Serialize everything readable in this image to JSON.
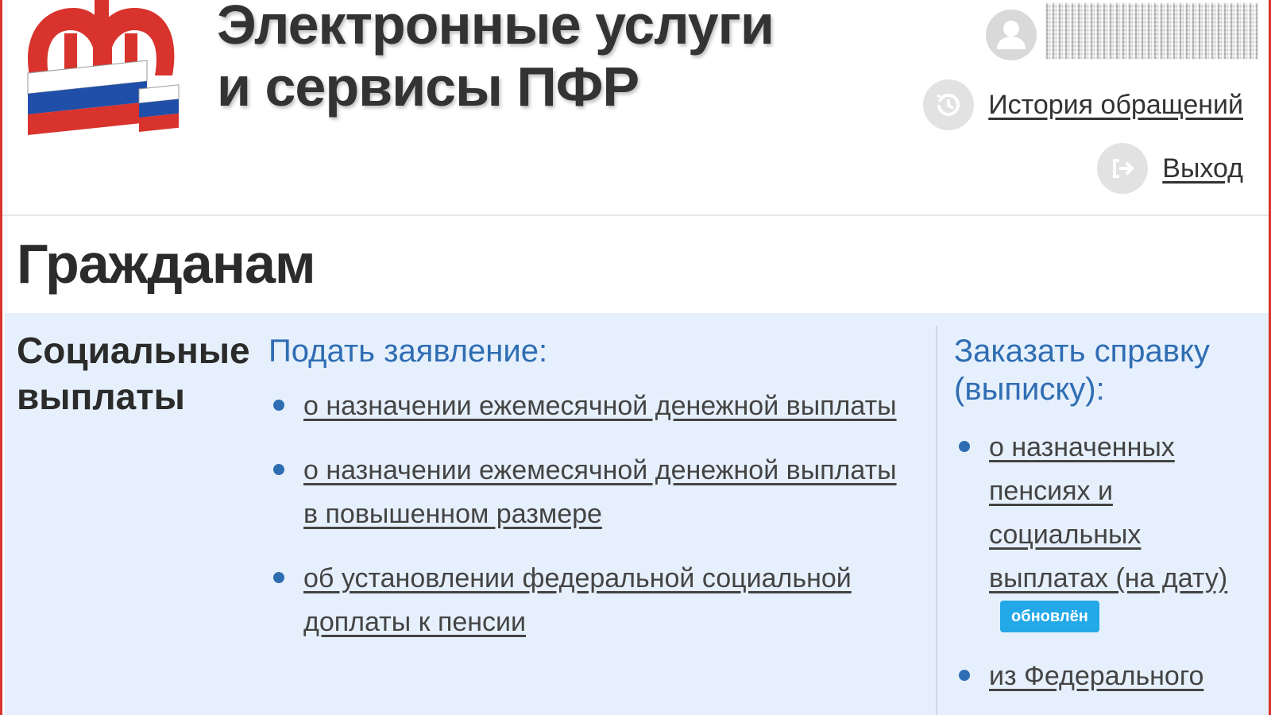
{
  "header": {
    "site_title_line1": "Электронные услуги",
    "site_title_line2": "и сервисы ПФР",
    "logo_text": "ПФР",
    "user_name": "",
    "history_link": "История обращений",
    "exit_link": "Выход"
  },
  "page": {
    "title": "Гражданам"
  },
  "section": {
    "title_line1": "Социальные",
    "title_line2": "выплаты",
    "apply": {
      "heading": "Подать заявление:",
      "items": [
        {
          "label": "о назначении ежемесячной денежной выплаты"
        },
        {
          "label": "о назначении ежемесячной денежной выплаты в повышенном размере"
        },
        {
          "label": "об установлении федеральной социальной доплаты к пенсии"
        }
      ]
    },
    "order": {
      "heading": "Заказать справку (выписку):",
      "items": [
        {
          "label": "о назначенных пенсиях и социальных выплатах (на дату)",
          "badge": "обновлён"
        },
        {
          "label": "из Федерального"
        }
      ]
    }
  },
  "colors": {
    "brand_red": "#d8332c",
    "link_blue": "#2f6db3",
    "panel_bg": "#e6f0fd",
    "badge_bg": "#23a9e8"
  },
  "icons": {
    "user": "user-avatar-icon",
    "history": "history-icon",
    "exit": "exit-icon",
    "bullet": "bullet-icon"
  }
}
